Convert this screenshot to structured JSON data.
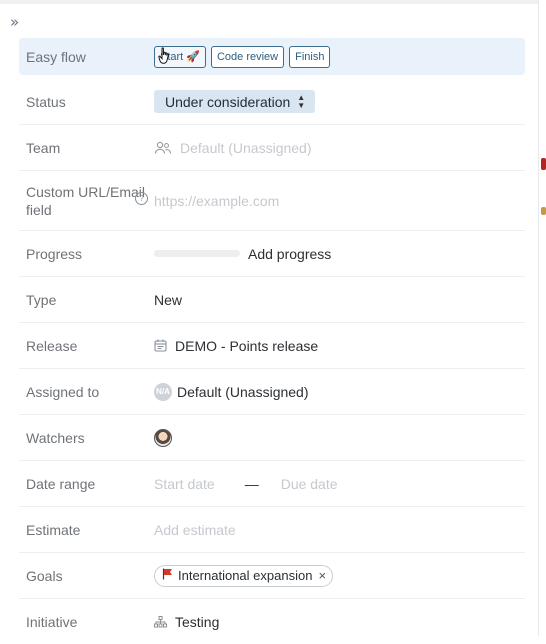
{
  "toolbar": {
    "collapse_icon": "double-chevron-right-icon",
    "collapse_glyph": "»"
  },
  "easy_flow": {
    "label": "Easy flow",
    "buttons": [
      {
        "label": "Start 🚀"
      },
      {
        "label": "Code review"
      },
      {
        "label": "Finish"
      }
    ]
  },
  "status": {
    "label": "Status",
    "value": "Under consideration"
  },
  "team": {
    "label": "Team",
    "placeholder": "Default (Unassigned)",
    "icon": "team-icon"
  },
  "custom_url": {
    "label": "Custom URL/Email field",
    "placeholder": "https://example.com",
    "help_icon": "help-icon"
  },
  "progress": {
    "label": "Progress",
    "action": "Add progress",
    "fraction": 0
  },
  "type": {
    "label": "Type",
    "value": "New"
  },
  "release": {
    "label": "Release",
    "value": "DEMO - Points release",
    "icon": "calendar-icon"
  },
  "assigned_to": {
    "label": "Assigned to",
    "avatar_text": "N/A",
    "value": "Default (Unassigned)"
  },
  "watchers": {
    "label": "Watchers"
  },
  "date_range": {
    "label": "Date range",
    "start_placeholder": "Start date",
    "separator": "—",
    "due_placeholder": "Due date"
  },
  "estimate": {
    "label": "Estimate",
    "placeholder": "Add estimate"
  },
  "goals": {
    "label": "Goals",
    "chip": "International expansion",
    "remove": "×",
    "chip_icon": "flag-icon"
  },
  "initiative": {
    "label": "Initiative",
    "value": "Testing",
    "icon": "hierarchy-icon"
  },
  "colors": {
    "highlight_row": "#e9f1fb",
    "status_bg": "#d9e6f2",
    "flow_button_border": "#3c6e8f"
  }
}
